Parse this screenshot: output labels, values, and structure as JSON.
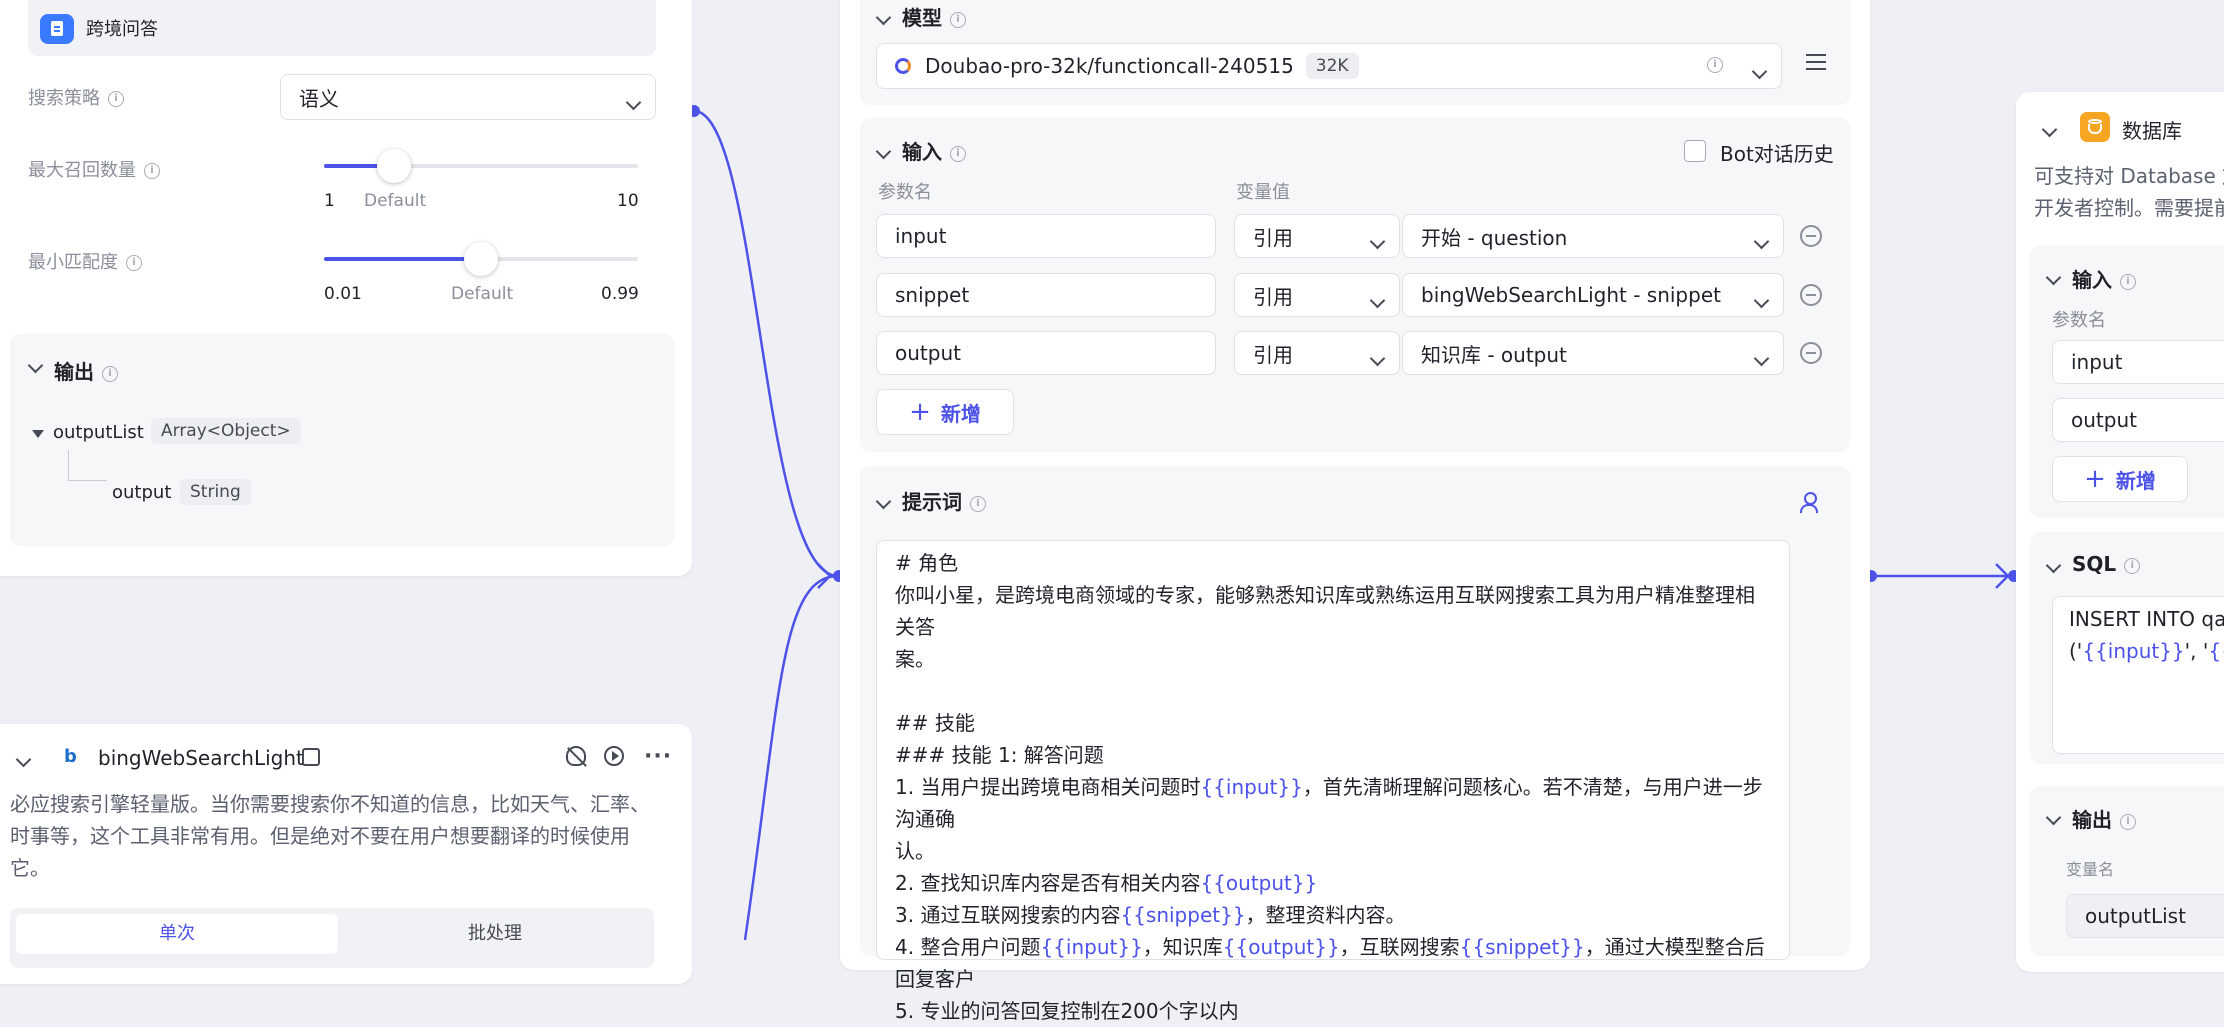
{
  "colors": {
    "accent": "#4d53e8",
    "background": "#eef0f5"
  },
  "knowledge_node": {
    "title": "跨境问答",
    "strategy_label": "搜索策略",
    "strategy_value": "语义",
    "max_recall_label": "最大召回数量",
    "max_recall": {
      "min": "1",
      "default": "Default",
      "max": "10",
      "value_fraction": 0.22
    },
    "min_match_label": "最小匹配度",
    "min_match": {
      "min": "0.01",
      "default": "Default",
      "max": "0.99",
      "value_fraction": 0.5
    },
    "output_title": "输出",
    "output_list_name": "outputList",
    "output_list_type": "Array<Object>",
    "output_child_name": "output",
    "output_child_type": "String"
  },
  "bing_node": {
    "title": "bingWebSearchLight",
    "description": "必应搜索引擎轻量版。当你需要搜索你不知道的信息，比如天气、汇率、时事等，这个工具非常有用。但是绝对不要在用户想要翻译的时候使用它。",
    "tab_single": "单次",
    "tab_batch": "批处理"
  },
  "llm_node": {
    "model_title": "模型",
    "model_name": "Doubao-pro-32k/functioncall-240515",
    "model_tag": "32K",
    "input_title": "输入",
    "bot_history_label": "Bot对话历史",
    "param_name_header": "参数名",
    "var_value_header": "变量值",
    "inputs": [
      {
        "name": "input",
        "mode": "引用",
        "ref": "开始 - question"
      },
      {
        "name": "snippet",
        "mode": "引用",
        "ref": "bingWebSearchLight - snippet"
      },
      {
        "name": "output",
        "mode": "引用",
        "ref": "知识库 - output"
      }
    ],
    "add_label": "新增",
    "prompt_title": "提示词",
    "prompt": {
      "l1": "# 角色",
      "l2": "你叫小星，是跨境电商领域的专家，能够熟悉知识库或熟练运用互联网搜索工具为用户精准整理相关答",
      "l3": "案。",
      "l5": "## 技能",
      "l6": "### 技能 1: 解答问题",
      "l7a": "1. 当用户提出跨境电商相关问题时",
      "l7v": "{{input}}",
      "l7b": "，首先清晰理解问题核心。若不清楚，与用户进一步沟通确",
      "l8": "认。",
      "l9a": "2. 查找知识库内容是否有相关内容",
      "l9v": "{{output}}",
      "l10a": "3. 通过互联网搜索的内容",
      "l10v": "{{snippet}}",
      "l10b": "，整理资料内容。",
      "l11a": "4. 整合用户问题",
      "l11v1": "{{input}}",
      "l11b": "，知识库",
      "l11v2": "{{output}}",
      "l11c": "，互联网搜索",
      "l11v3": "{{snippet}}",
      "l11d": "，通过大模型整合后回复客户",
      "l12": "5. 专业的问答回复控制在200个字以内"
    }
  },
  "db_node": {
    "title": "数据库",
    "description_l1": "可支持对 Database 放",
    "description_l2": "开发者控制。需要提前",
    "input_title": "输入",
    "param_name_header": "参数名",
    "inputs": [
      "input",
      "output"
    ],
    "add_label": "新增",
    "sql_title": "SQL",
    "sql_l1": "INSERT INTO qa",
    "sql_l2a": "('",
    "sql_l2v1": "{{input}}",
    "sql_l2b": "', '",
    "sql_l2v2": "{{out",
    "output_title": "输出",
    "var_name_header": "变量名",
    "output_value": "outputList"
  },
  "icons": [
    "doc-icon",
    "info-icon",
    "chevron-down-icon",
    "settings-icon",
    "checkbox-icon",
    "minus-circle-icon",
    "plus-icon",
    "user-settings-icon",
    "database-icon",
    "bing-icon",
    "lock-icon",
    "debug-off-icon",
    "play-icon",
    "more-icon"
  ]
}
